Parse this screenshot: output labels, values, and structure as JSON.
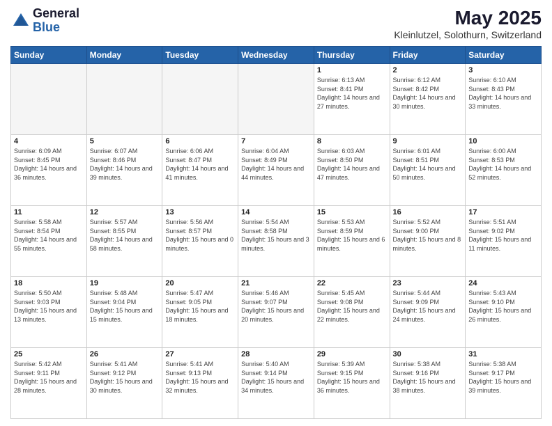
{
  "logo": {
    "general": "General",
    "blue": "Blue"
  },
  "title": {
    "month": "May 2025",
    "location": "Kleinlutzel, Solothurn, Switzerland"
  },
  "weekdays": [
    "Sunday",
    "Monday",
    "Tuesday",
    "Wednesday",
    "Thursday",
    "Friday",
    "Saturday"
  ],
  "weeks": [
    [
      {
        "day": "",
        "empty": true
      },
      {
        "day": "",
        "empty": true
      },
      {
        "day": "",
        "empty": true
      },
      {
        "day": "",
        "empty": true
      },
      {
        "day": "1",
        "sunrise": "6:13 AM",
        "sunset": "8:41 PM",
        "daylight": "14 hours and 27 minutes."
      },
      {
        "day": "2",
        "sunrise": "6:12 AM",
        "sunset": "8:42 PM",
        "daylight": "14 hours and 30 minutes."
      },
      {
        "day": "3",
        "sunrise": "6:10 AM",
        "sunset": "8:43 PM",
        "daylight": "14 hours and 33 minutes."
      }
    ],
    [
      {
        "day": "4",
        "sunrise": "6:09 AM",
        "sunset": "8:45 PM",
        "daylight": "14 hours and 36 minutes."
      },
      {
        "day": "5",
        "sunrise": "6:07 AM",
        "sunset": "8:46 PM",
        "daylight": "14 hours and 39 minutes."
      },
      {
        "day": "6",
        "sunrise": "6:06 AM",
        "sunset": "8:47 PM",
        "daylight": "14 hours and 41 minutes."
      },
      {
        "day": "7",
        "sunrise": "6:04 AM",
        "sunset": "8:49 PM",
        "daylight": "14 hours and 44 minutes."
      },
      {
        "day": "8",
        "sunrise": "6:03 AM",
        "sunset": "8:50 PM",
        "daylight": "14 hours and 47 minutes."
      },
      {
        "day": "9",
        "sunrise": "6:01 AM",
        "sunset": "8:51 PM",
        "daylight": "14 hours and 50 minutes."
      },
      {
        "day": "10",
        "sunrise": "6:00 AM",
        "sunset": "8:53 PM",
        "daylight": "14 hours and 52 minutes."
      }
    ],
    [
      {
        "day": "11",
        "sunrise": "5:58 AM",
        "sunset": "8:54 PM",
        "daylight": "14 hours and 55 minutes."
      },
      {
        "day": "12",
        "sunrise": "5:57 AM",
        "sunset": "8:55 PM",
        "daylight": "14 hours and 58 minutes."
      },
      {
        "day": "13",
        "sunrise": "5:56 AM",
        "sunset": "8:57 PM",
        "daylight": "15 hours and 0 minutes."
      },
      {
        "day": "14",
        "sunrise": "5:54 AM",
        "sunset": "8:58 PM",
        "daylight": "15 hours and 3 minutes."
      },
      {
        "day": "15",
        "sunrise": "5:53 AM",
        "sunset": "8:59 PM",
        "daylight": "15 hours and 6 minutes."
      },
      {
        "day": "16",
        "sunrise": "5:52 AM",
        "sunset": "9:00 PM",
        "daylight": "15 hours and 8 minutes."
      },
      {
        "day": "17",
        "sunrise": "5:51 AM",
        "sunset": "9:02 PM",
        "daylight": "15 hours and 11 minutes."
      }
    ],
    [
      {
        "day": "18",
        "sunrise": "5:50 AM",
        "sunset": "9:03 PM",
        "daylight": "15 hours and 13 minutes."
      },
      {
        "day": "19",
        "sunrise": "5:48 AM",
        "sunset": "9:04 PM",
        "daylight": "15 hours and 15 minutes."
      },
      {
        "day": "20",
        "sunrise": "5:47 AM",
        "sunset": "9:05 PM",
        "daylight": "15 hours and 18 minutes."
      },
      {
        "day": "21",
        "sunrise": "5:46 AM",
        "sunset": "9:07 PM",
        "daylight": "15 hours and 20 minutes."
      },
      {
        "day": "22",
        "sunrise": "5:45 AM",
        "sunset": "9:08 PM",
        "daylight": "15 hours and 22 minutes."
      },
      {
        "day": "23",
        "sunrise": "5:44 AM",
        "sunset": "9:09 PM",
        "daylight": "15 hours and 24 minutes."
      },
      {
        "day": "24",
        "sunrise": "5:43 AM",
        "sunset": "9:10 PM",
        "daylight": "15 hours and 26 minutes."
      }
    ],
    [
      {
        "day": "25",
        "sunrise": "5:42 AM",
        "sunset": "9:11 PM",
        "daylight": "15 hours and 28 minutes."
      },
      {
        "day": "26",
        "sunrise": "5:41 AM",
        "sunset": "9:12 PM",
        "daylight": "15 hours and 30 minutes."
      },
      {
        "day": "27",
        "sunrise": "5:41 AM",
        "sunset": "9:13 PM",
        "daylight": "15 hours and 32 minutes."
      },
      {
        "day": "28",
        "sunrise": "5:40 AM",
        "sunset": "9:14 PM",
        "daylight": "15 hours and 34 minutes."
      },
      {
        "day": "29",
        "sunrise": "5:39 AM",
        "sunset": "9:15 PM",
        "daylight": "15 hours and 36 minutes."
      },
      {
        "day": "30",
        "sunrise": "5:38 AM",
        "sunset": "9:16 PM",
        "daylight": "15 hours and 38 minutes."
      },
      {
        "day": "31",
        "sunrise": "5:38 AM",
        "sunset": "9:17 PM",
        "daylight": "15 hours and 39 minutes."
      }
    ]
  ]
}
